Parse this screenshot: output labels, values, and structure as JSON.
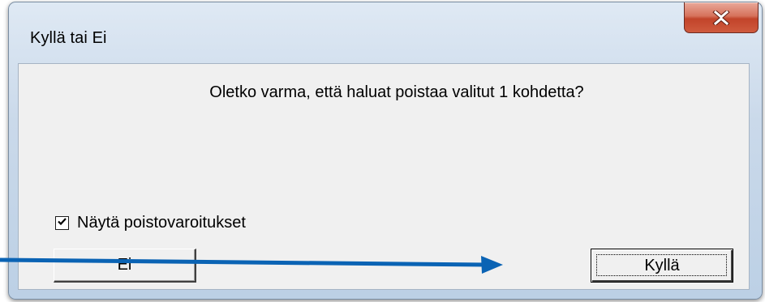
{
  "window": {
    "title": "Kyllä tai Ei",
    "frame_color": "#bcd0e5",
    "close_button_color": "#c2442a"
  },
  "dialog": {
    "message": "Oletko varma, että haluat poistaa valitut 1 kohdetta?",
    "checkbox": {
      "label": "Näytä poistovaroitukset",
      "checked": true
    },
    "buttons": {
      "no_label": "Ei",
      "yes_label": "Kyllä",
      "default": "yes"
    }
  },
  "annotation": {
    "type": "arrow",
    "color": "#0a63b4",
    "points_to": "yes_button"
  },
  "icons": {
    "close": "close-icon",
    "check": "checkmark-icon"
  }
}
